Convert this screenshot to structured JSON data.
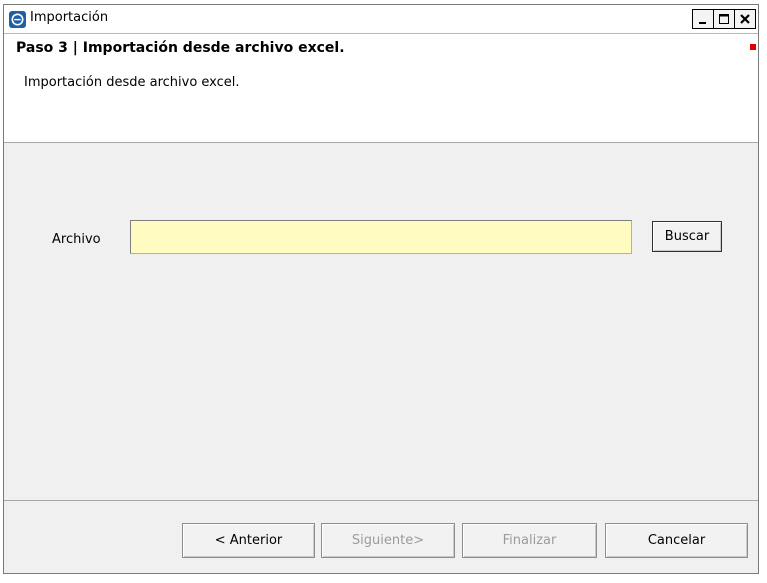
{
  "window": {
    "title": "Importación",
    "icon": "app-e-icon",
    "controls": [
      "minimize-icon",
      "maximize-icon",
      "close-icon"
    ]
  },
  "header": {
    "step_title": "Paso 3 | Importación desde archivo excel.",
    "step_description": "Importación desde archivo excel."
  },
  "form": {
    "file_label": "Archivo",
    "file_value": "",
    "file_placeholder": "",
    "browse_button": "Buscar",
    "input_background": "#fffbc1"
  },
  "footer": {
    "previous_button": "< Anterior",
    "next_button": "Siguiente>",
    "finish_button": "Finalizar",
    "cancel_button": "Cancelar",
    "next_enabled": false,
    "finish_enabled": false
  }
}
